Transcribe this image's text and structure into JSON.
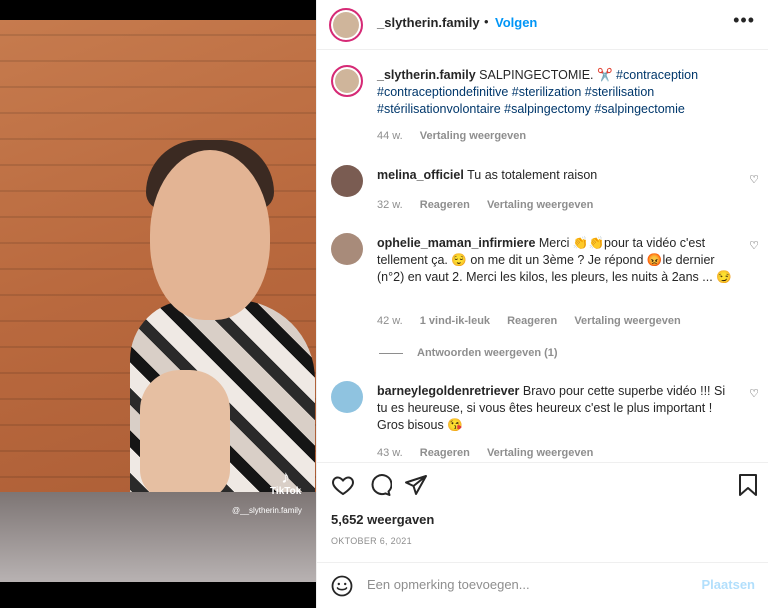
{
  "media": {
    "watermark": "TikTok",
    "watermark_handle": "@__slytherin.family"
  },
  "header": {
    "username": "_slytherin.family",
    "separator": "•",
    "follow_label": "Volgen",
    "more_icon": "more-horizontal-icon"
  },
  "caption": {
    "username": "_slytherin.family",
    "text": "SALPINGECTOMIE. ✂️",
    "hashtags": "#contraception #contraceptiondefinitive #sterilization #sterilisation #stérilisationvolontaire #salpingectomy #salpingectomie",
    "age": "44 w.",
    "translate": "Vertaling weergeven"
  },
  "comments": [
    {
      "username": "melina_officiel",
      "text": "Tu as totalement raison",
      "age": "32 w.",
      "reply": "Reageren",
      "translate": "Vertaling weergeven"
    },
    {
      "username": "ophelie_maman_infirmiere",
      "text": "Merci 👏👏pour ta vidéo c'est tellement ça. 😌 on me dit un 3ème ? Je répond 😡le dernier (n°2) en vaut 2. Merci les kilos, les pleurs, les nuits à 2ans ... 😏",
      "age": "42 w.",
      "likes": "1 vind-ik-leuk",
      "reply": "Reageren",
      "translate": "Vertaling weergeven",
      "view_replies": "Antwoorden weergeven (1)"
    },
    {
      "username": "barneylegoldenretriever",
      "text": "Bravo pour cette superbe vidéo !!! Si tu es heureuse, si vous êtes heureux c'est le plus important ! Gros bisous 😘",
      "age": "43 w.",
      "reply": "Reageren",
      "translate": "Vertaling weergeven"
    }
  ],
  "actions": {
    "like_icon": "heart-icon",
    "comment_icon": "comment-icon",
    "share_icon": "paper-plane-icon",
    "save_icon": "bookmark-icon"
  },
  "stats": {
    "views": "5,652 weergaven",
    "date": "OKTOBER 6, 2021"
  },
  "composer": {
    "placeholder": "Een opmerking toevoegen...",
    "post_label": "Plaatsen"
  },
  "colors": {
    "link_blue": "#0095f6",
    "hashtag": "#00376b",
    "muted": "#8e8e8e",
    "post_disabled": "#b2dffc"
  }
}
